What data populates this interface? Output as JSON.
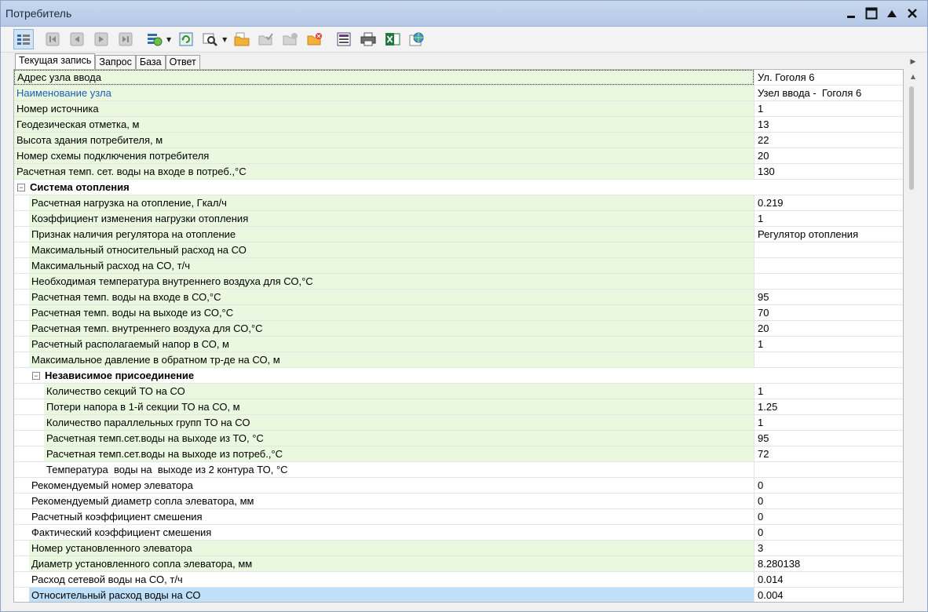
{
  "window": {
    "title": "Потребитель",
    "controls": {
      "minimize": "▁",
      "maximize": "☐",
      "restore": "▲",
      "close": "✕"
    }
  },
  "toolbar": {
    "icons": [
      "view-list-icon",
      "first-record-icon",
      "prev-record-icon",
      "next-record-icon",
      "last-record-icon",
      "filter-icon",
      "refresh-icon",
      "search-icon",
      "open-folder-icon",
      "folder-check-icon",
      "folder-add-icon",
      "folder-delete-icon",
      "save-report-icon",
      "print-icon",
      "excel-icon",
      "web-export-icon"
    ]
  },
  "tabs": [
    {
      "label": "Текущая запись",
      "active": true
    },
    {
      "label": "Запрос",
      "active": false
    },
    {
      "label": "База",
      "active": false
    },
    {
      "label": "Ответ",
      "active": false
    }
  ],
  "rows": [
    {
      "name": "Адрес узла ввода",
      "value": "Ул. Гоголя 6",
      "level": 0,
      "style": "green",
      "first": true
    },
    {
      "name": "Наименование узла",
      "value": "Узел ввода -  Гоголя 6",
      "level": 0,
      "style": "green",
      "link": true
    },
    {
      "name": "Номер источника",
      "value": "1",
      "level": 0,
      "style": "green"
    },
    {
      "name": "Геодезическая отметка, м",
      "value": "13",
      "level": 0,
      "style": "green"
    },
    {
      "name": "Высота здания потребителя, м",
      "value": "22",
      "level": 0,
      "style": "green"
    },
    {
      "name": "Номер схемы подключения потребителя",
      "value": "20",
      "level": 0,
      "style": "green"
    },
    {
      "name": "Расчетная темп. сет. воды на входе в потреб.,°С",
      "value": "130",
      "level": 0,
      "style": "green"
    },
    {
      "name": "Система отопления",
      "value": "",
      "level": 0,
      "style": "section",
      "toggle": "−"
    },
    {
      "name": "Расчетная нагрузка на отопление, Гкал/ч",
      "value": "0.219",
      "level": 1,
      "style": "green"
    },
    {
      "name": "Коэффициент изменения нагрузки отопления",
      "value": "1",
      "level": 1,
      "style": "green"
    },
    {
      "name": "Признак наличия регулятора на отопление",
      "value": "Регулятор отопления",
      "level": 1,
      "style": "green"
    },
    {
      "name": "Максимальный относительный расход на СО",
      "value": "",
      "level": 1,
      "style": "green"
    },
    {
      "name": "Максимальный расход на СО, т/ч",
      "value": "",
      "level": 1,
      "style": "green"
    },
    {
      "name": "Необходимая температура внутреннего воздуха для СО,°С",
      "value": "",
      "level": 1,
      "style": "green"
    },
    {
      "name": "Расчетная темп. воды на входе в СО,°С",
      "value": "95",
      "level": 1,
      "style": "green"
    },
    {
      "name": "Расчетная темп. воды на выходе из СО,°С",
      "value": "70",
      "level": 1,
      "style": "green"
    },
    {
      "name": "Расчетная темп. внутреннего воздуха для СО,°С",
      "value": "20",
      "level": 1,
      "style": "green"
    },
    {
      "name": "Расчетный располагаемый напор в СО, м",
      "value": "1",
      "level": 1,
      "style": "green"
    },
    {
      "name": "Максимальное давление в обратном тр-де на СО, м",
      "value": "",
      "level": 1,
      "style": "green"
    },
    {
      "name": "Независимое присоединение",
      "value": "",
      "level": 1,
      "style": "section",
      "toggle": "−"
    },
    {
      "name": "Количество секций ТО на СО",
      "value": "1",
      "level": 2,
      "style": "green"
    },
    {
      "name": "Потери напора в 1-й секции ТО на СО, м",
      "value": "1.25",
      "level": 2,
      "style": "green"
    },
    {
      "name": "Количество параллельных групп ТО на СО",
      "value": "1",
      "level": 2,
      "style": "green"
    },
    {
      "name": "Расчетная темп.сет.воды на выходе из ТО, °С",
      "value": "95",
      "level": 2,
      "style": "green"
    },
    {
      "name": "Расчетная темп.сет.воды на выходе из потреб.,°С",
      "value": "72",
      "level": 2,
      "style": "green"
    },
    {
      "name": "Температура  воды на  выходе из 2 контура ТО, °С",
      "value": "",
      "level": 2,
      "style": "white"
    },
    {
      "name": "Рекомендуемый номер элеватора",
      "value": "0",
      "level": 1,
      "style": "white"
    },
    {
      "name": "Рекомендуемый диаметр сопла элеватора, мм",
      "value": "0",
      "level": 1,
      "style": "white"
    },
    {
      "name": "Расчетный коэффициент смешения",
      "value": "0",
      "level": 1,
      "style": "white"
    },
    {
      "name": "Фактический коэффициент смешения",
      "value": "0",
      "level": 1,
      "style": "white"
    },
    {
      "name": "Номер установленного элеватора",
      "value": "3",
      "level": 1,
      "style": "green"
    },
    {
      "name": "Диаметр установленного сопла элеватора, мм",
      "value": "8.280138",
      "level": 1,
      "style": "green"
    },
    {
      "name": "Расход сетевой воды на СО, т/ч",
      "value": "0.014",
      "level": 1,
      "style": "white"
    },
    {
      "name": "Относительный расход воды на СО",
      "value": "0.004",
      "level": 1,
      "style": "selected"
    }
  ]
}
